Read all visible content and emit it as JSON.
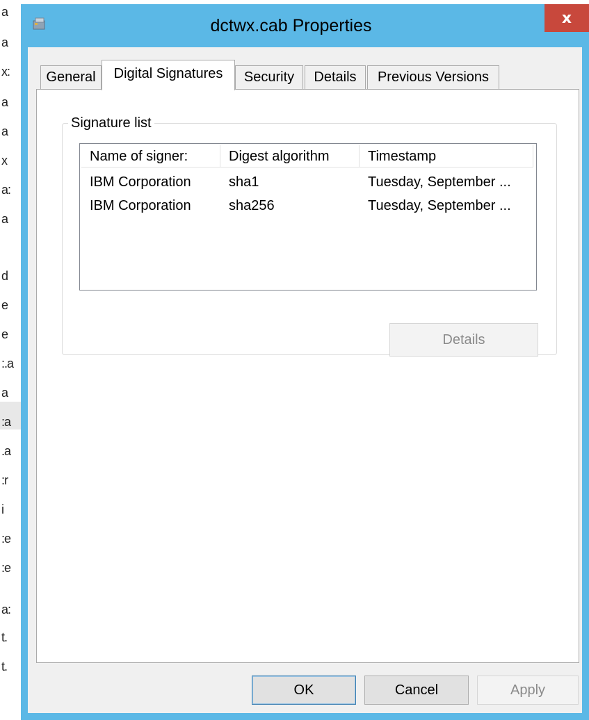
{
  "background": {
    "list_fragments": [
      "a",
      "a",
      "x:",
      "a",
      "a",
      "x",
      "a:",
      "a",
      "d",
      "e",
      "e",
      ":.a",
      "a",
      ":a",
      ".a",
      ":r",
      "i",
      ":e",
      ":e",
      "a:",
      "t.",
      "t."
    ]
  },
  "window": {
    "title": "dctwx.cab Properties",
    "close_glyph": "x",
    "app_icon": "cabinet-file-icon"
  },
  "tabs": [
    {
      "label": "General"
    },
    {
      "label": "Digital Signatures",
      "active": true
    },
    {
      "label": "Security"
    },
    {
      "label": "Details"
    },
    {
      "label": "Previous Versions"
    }
  ],
  "signature_group": {
    "label": "Signature list",
    "columns": [
      "Name of signer:",
      "Digest algorithm",
      "Timestamp"
    ],
    "rows": [
      [
        "IBM Corporation",
        "sha1",
        "Tuesday, September ..."
      ],
      [
        "IBM Corporation",
        "sha256",
        "Tuesday, September ..."
      ]
    ],
    "details_button": "Details"
  },
  "buttons": {
    "ok": "OK",
    "cancel": "Cancel",
    "apply": "Apply"
  },
  "colors": {
    "title_bar": "#5bb8e6",
    "close_button": "#c8483c",
    "dialog_body": "#f0f0f0"
  }
}
